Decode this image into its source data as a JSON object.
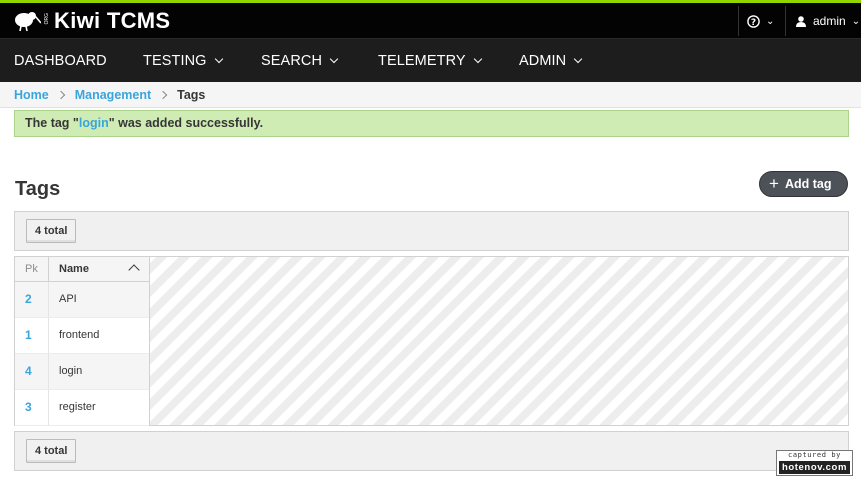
{
  "brand": {
    "org": "ORG",
    "name": "Kiwi TCMS"
  },
  "header": {
    "help_icon": "question-circle-icon",
    "user_icon": "user-icon",
    "username": "admin"
  },
  "nav": {
    "dashboard": "DASHBOARD",
    "testing": "TESTING",
    "search": "SEARCH",
    "telemetry": "TELEMETRY",
    "admin": "ADMIN"
  },
  "breadcrumb": {
    "home": "Home",
    "management": "Management",
    "current": "Tags"
  },
  "alert": {
    "prefix": "The tag \"",
    "tag": "login",
    "suffix": "\" was added successfully."
  },
  "page": {
    "title": "Tags",
    "add_button": "Add tag",
    "add_icon": "plus-icon"
  },
  "toolbar": {
    "total_label": "4 total"
  },
  "table": {
    "columns": {
      "pk": "Pk",
      "name": "Name"
    },
    "sort": "ascending",
    "rows": [
      {
        "pk": "2",
        "name": "API"
      },
      {
        "pk": "1",
        "name": "frontend"
      },
      {
        "pk": "4",
        "name": "login"
      },
      {
        "pk": "3",
        "name": "register"
      }
    ]
  },
  "badge": {
    "line1": "captured by",
    "line2": "hotenov.com"
  },
  "colors": {
    "accent_bar": "#92d400",
    "link": "#39a5dc",
    "alert_bg": "#cfecb4",
    "topbar": "#030303",
    "navbar": "#1d1d1d"
  }
}
